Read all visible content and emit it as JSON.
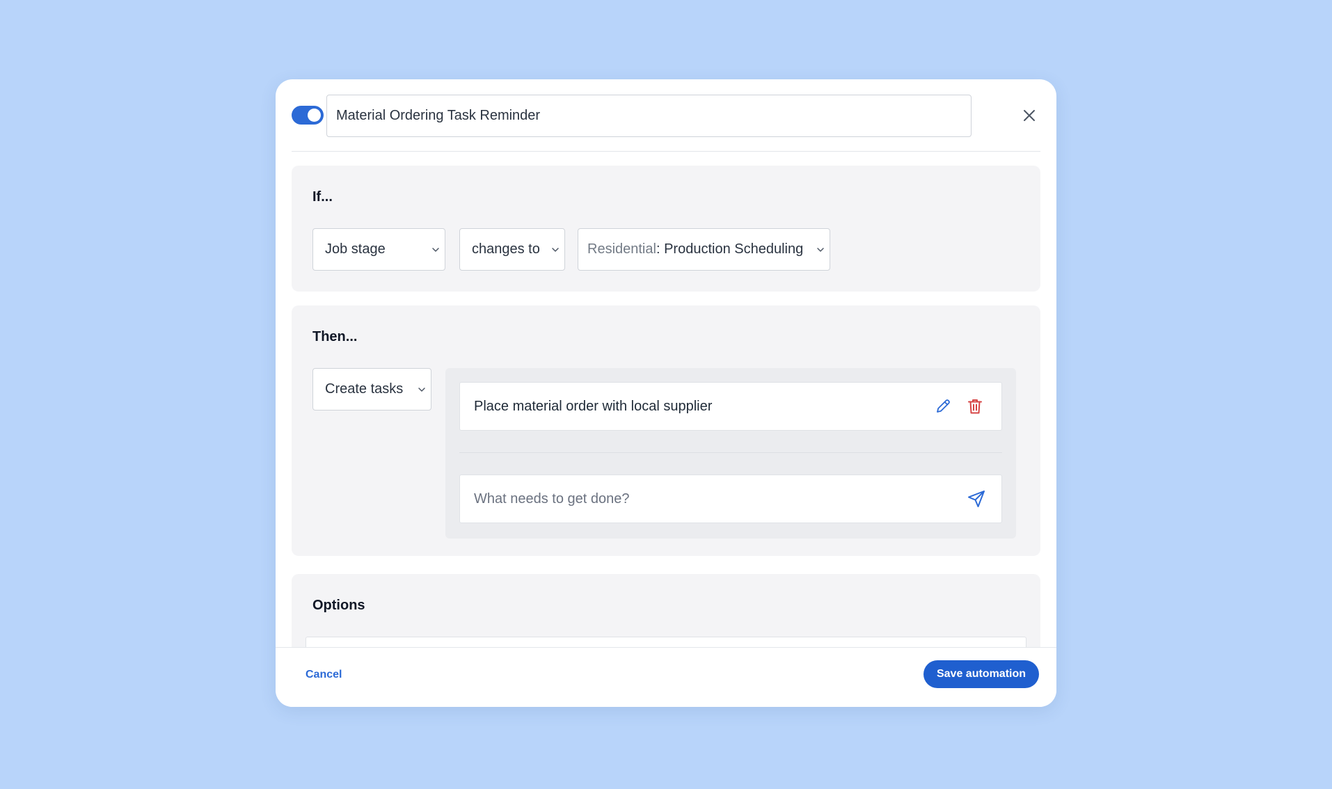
{
  "header": {
    "toggle_on": true,
    "title_value": "Material Ordering Task Reminder",
    "close_icon": "close-icon"
  },
  "if_section": {
    "title": "If...",
    "field_select": "Job stage",
    "operator_select": "changes to",
    "value_prefix": "Residential",
    "value_separator": ":",
    "value_main": "Production Scheduling"
  },
  "then_section": {
    "title": "Then...",
    "action_select": "Create tasks",
    "tasks": [
      {
        "label": "Place material order with local supplier"
      }
    ],
    "new_task_placeholder": "What needs to get done?"
  },
  "options_section": {
    "title": "Options"
  },
  "footer": {
    "cancel_label": "Cancel",
    "save_label": "Save automation"
  },
  "colors": {
    "background": "#b8d4fa",
    "accent": "#2c6ad6",
    "delete": "#d64545"
  }
}
